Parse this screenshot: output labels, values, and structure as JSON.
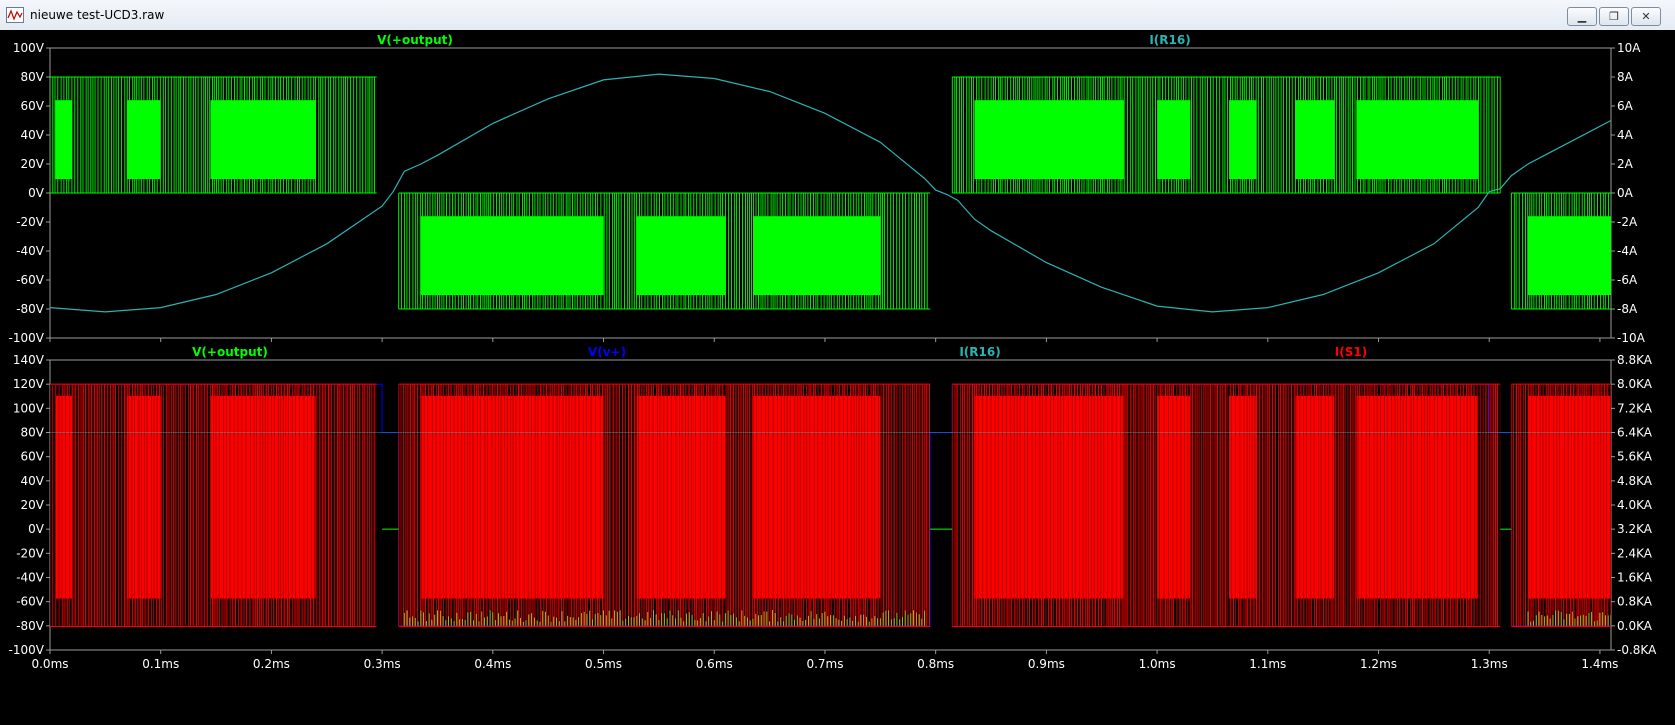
{
  "window": {
    "title": "nieuwe test-UCD3.raw",
    "min_label": "▁",
    "max_label": "❐",
    "close_label": "✕"
  },
  "colors": {
    "background": "#000000",
    "frame": "#9a9a9a",
    "green": "#00ff00",
    "cyan": "#2ab3b3",
    "blue": "#0000ff",
    "red": "#ff0000",
    "darkred": "#8a0000"
  },
  "chart_data": [
    {
      "type": "line",
      "title": "",
      "x_unit": "ms",
      "xlim": [
        0,
        1.41
      ],
      "x_ticks": [
        "0.0ms",
        "0.1ms",
        "0.2ms",
        "0.3ms",
        "0.4ms",
        "0.5ms",
        "0.6ms",
        "0.7ms",
        "0.8ms",
        "0.9ms",
        "1.0ms",
        "1.1ms",
        "1.2ms",
        "1.3ms",
        "1.4ms"
      ],
      "ylim_left": [
        -100,
        100
      ],
      "y_ticks_left": [
        "100V",
        "80V",
        "60V",
        "40V",
        "20V",
        "0V",
        "-20V",
        "-40V",
        "-60V",
        "-80V",
        "-100V"
      ],
      "ylim_right": [
        -10,
        10
      ],
      "y_ticks_right": [
        "10A",
        "8A",
        "6A",
        "4A",
        "2A",
        "0A",
        "-2A",
        "-4A",
        "-6A",
        "-8A",
        "-10A"
      ],
      "series": [
        {
          "name": "V(+output)",
          "axis": "left",
          "color": "#00ff00",
          "kind": "pwm",
          "segments": [
            {
              "x0": 0.0,
              "x1": 0.295,
              "low": 0,
              "high": 80,
              "dense": [
                [
                  0.005,
                  0.02
                ],
                [
                  0.07,
                  0.1
                ],
                [
                  0.145,
                  0.24
                ]
              ]
            },
            {
              "x0": 0.315,
              "x1": 0.795,
              "low": -80,
              "high": 0,
              "dense": [
                [
                  0.335,
                  0.5
                ],
                [
                  0.53,
                  0.61
                ],
                [
                  0.635,
                  0.75
                ]
              ]
            },
            {
              "x0": 0.815,
              "x1": 1.31,
              "low": 0,
              "high": 80,
              "dense": [
                [
                  0.835,
                  0.97
                ],
                [
                  1.0,
                  1.03
                ],
                [
                  1.065,
                  1.09
                ],
                [
                  1.125,
                  1.16
                ],
                [
                  1.18,
                  1.29
                ]
              ]
            },
            {
              "x0": 1.32,
              "x1": 1.41,
              "low": -80,
              "high": 0,
              "dense": [
                [
                  1.335,
                  1.41
                ]
              ]
            }
          ]
        },
        {
          "name": "I(R16)",
          "axis": "right",
          "color": "#2ab3b3",
          "kind": "sine",
          "amplitude": 8.2,
          "period": 0.98,
          "zero_cross": 0.305,
          "points": [
            [
              0,
              -7.9
            ],
            [
              0.05,
              -8.2
            ],
            [
              0.1,
              -7.9
            ],
            [
              0.15,
              -7.0
            ],
            [
              0.2,
              -5.5
            ],
            [
              0.25,
              -3.5
            ],
            [
              0.3,
              -0.9
            ],
            [
              0.31,
              0.1
            ],
            [
              0.32,
              1.5
            ],
            [
              0.335,
              2.0
            ],
            [
              0.35,
              2.6
            ],
            [
              0.4,
              4.8
            ],
            [
              0.45,
              6.5
            ],
            [
              0.5,
              7.8
            ],
            [
              0.55,
              8.2
            ],
            [
              0.6,
              7.9
            ],
            [
              0.65,
              7.0
            ],
            [
              0.7,
              5.5
            ],
            [
              0.75,
              3.5
            ],
            [
              0.79,
              1.0
            ],
            [
              0.8,
              0.2
            ],
            [
              0.81,
              -0.1
            ],
            [
              0.82,
              -0.5
            ],
            [
              0.835,
              -1.8
            ],
            [
              0.85,
              -2.6
            ],
            [
              0.9,
              -4.8
            ],
            [
              0.95,
              -6.5
            ],
            [
              1.0,
              -7.8
            ],
            [
              1.05,
              -8.2
            ],
            [
              1.1,
              -7.9
            ],
            [
              1.15,
              -7.0
            ],
            [
              1.2,
              -5.5
            ],
            [
              1.25,
              -3.5
            ],
            [
              1.29,
              -1.0
            ],
            [
              1.3,
              0.1
            ],
            [
              1.31,
              0.3
            ],
            [
              1.32,
              1.2
            ],
            [
              1.335,
              2.0
            ],
            [
              1.35,
              2.6
            ],
            [
              1.41,
              5.0
            ]
          ]
        }
      ]
    },
    {
      "type": "line",
      "title": "",
      "x_unit": "ms",
      "xlim": [
        0,
        1.41
      ],
      "x_ticks": [
        "0.0ms",
        "0.1ms",
        "0.2ms",
        "0.3ms",
        "0.4ms",
        "0.5ms",
        "0.6ms",
        "0.7ms",
        "0.8ms",
        "0.9ms",
        "1.0ms",
        "1.1ms",
        "1.2ms",
        "1.3ms",
        "1.4ms"
      ],
      "ylim_left": [
        -100,
        140
      ],
      "y_ticks_left": [
        "140V",
        "120V",
        "100V",
        "80V",
        "60V",
        "40V",
        "20V",
        "0V",
        "-20V",
        "-40V",
        "-60V",
        "-80V",
        "-100V"
      ],
      "ylim_right": [
        -0.8,
        8.8
      ],
      "y_ticks_right": [
        "8.8KA",
        "8.0KA",
        "7.2KA",
        "6.4KA",
        "5.6KA",
        "4.8KA",
        "4.0KA",
        "3.2KA",
        "2.4KA",
        "1.6KA",
        "0.8KA",
        "0.0KA",
        "-0.8KA"
      ],
      "series": [
        {
          "name": "V(+output)",
          "axis": "left",
          "color": "#00ff00"
        },
        {
          "name": "V(v+)",
          "axis": "left",
          "color": "#0000ff",
          "kind": "step",
          "points": [
            [
              0,
              120
            ],
            [
              0.3,
              120
            ],
            [
              0.3,
              80
            ],
            [
              0.315,
              80
            ],
            [
              0.315,
              -80
            ],
            [
              0.795,
              -80
            ],
            [
              0.795,
              80
            ],
            [
              0.815,
              80
            ],
            [
              0.815,
              120
            ],
            [
              1.3,
              120
            ],
            [
              1.3,
              80
            ],
            [
              1.32,
              80
            ],
            [
              1.32,
              -80
            ],
            [
              1.41,
              -80
            ]
          ]
        },
        {
          "name": "I(R16)",
          "axis": "right",
          "color": "#2ab3b3"
        },
        {
          "name": "I(S1)",
          "axis": "right",
          "color": "#ff0000",
          "kind": "pwm",
          "segments": [
            {
              "x0": 0.0,
              "x1": 0.295,
              "low": -0.02,
              "high": 8.0,
              "dense": [
                [
                  0.005,
                  0.02
                ],
                [
                  0.07,
                  0.1
                ],
                [
                  0.145,
                  0.24
                ]
              ]
            },
            {
              "x0": 0.315,
              "x1": 0.795,
              "low": -0.02,
              "high": 8.0,
              "dense": [
                [
                  0.335,
                  0.5
                ],
                [
                  0.53,
                  0.61
                ],
                [
                  0.635,
                  0.75
                ]
              ]
            },
            {
              "x0": 0.815,
              "x1": 1.31,
              "low": -0.02,
              "high": 8.0,
              "dense": [
                [
                  0.835,
                  0.97
                ],
                [
                  1.0,
                  1.03
                ],
                [
                  1.065,
                  1.09
                ],
                [
                  1.125,
                  1.16
                ],
                [
                  1.18,
                  1.29
                ]
              ]
            },
            {
              "x0": 1.32,
              "x1": 1.41,
              "low": -0.02,
              "high": 8.0,
              "dense": [
                [
                  1.335,
                  1.41
                ]
              ]
            }
          ]
        }
      ]
    }
  ]
}
